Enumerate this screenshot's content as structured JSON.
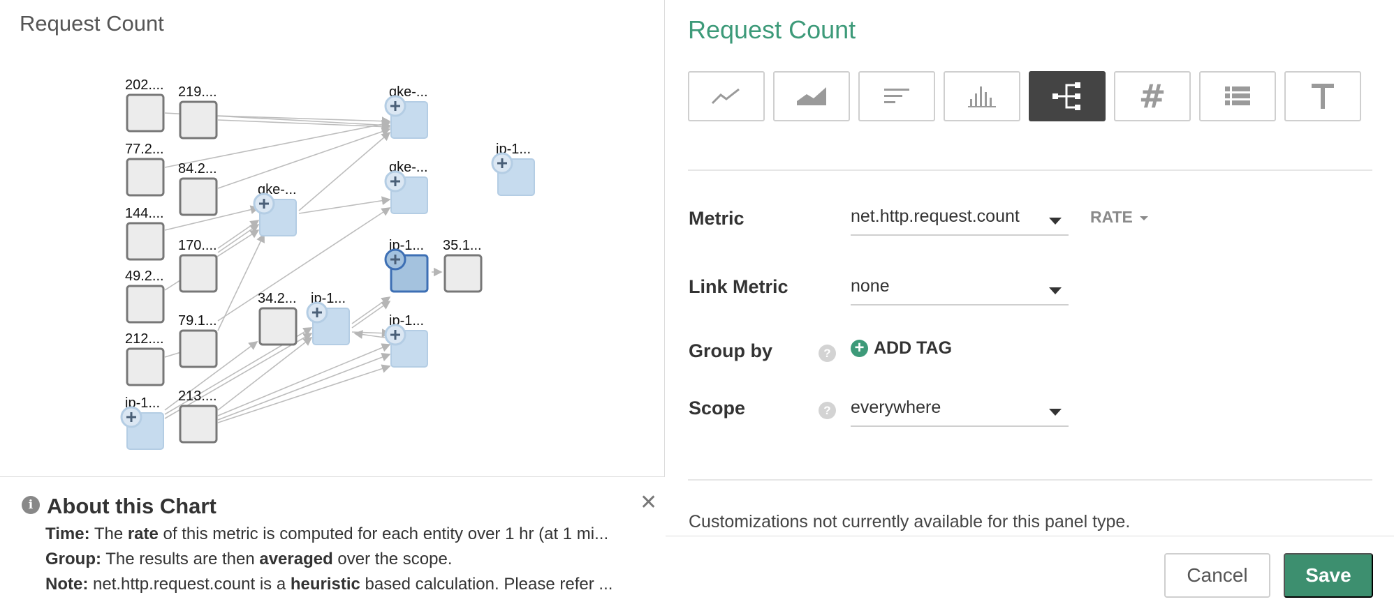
{
  "left": {
    "title": "Request Count"
  },
  "topology": {
    "nodes": [
      {
        "label": "202....",
        "kind": "gray"
      },
      {
        "label": "219....",
        "kind": "gray"
      },
      {
        "label": "77.2...",
        "kind": "gray"
      },
      {
        "label": "84.2...",
        "kind": "gray"
      },
      {
        "label": "144....",
        "kind": "gray"
      },
      {
        "label": "170....",
        "kind": "gray"
      },
      {
        "label": "49.2...",
        "kind": "gray"
      },
      {
        "label": "79.1...",
        "kind": "gray"
      },
      {
        "label": "212....",
        "kind": "gray"
      },
      {
        "label": "213....",
        "kind": "gray"
      },
      {
        "label": "ip-1...",
        "kind": "blue"
      },
      {
        "label": "34.2...",
        "kind": "gray"
      },
      {
        "label": "ip-1...",
        "kind": "blue"
      },
      {
        "label": "gke-...",
        "kind": "blue"
      },
      {
        "label": "gke-...",
        "kind": "blue"
      },
      {
        "label": "gke-...",
        "kind": "blue"
      },
      {
        "label": "ip-1...",
        "kind": "selected"
      },
      {
        "label": "35.1...",
        "kind": "gray"
      },
      {
        "label": "ip-1...",
        "kind": "blue"
      },
      {
        "label": "ip-1...",
        "kind": "blue"
      }
    ]
  },
  "about": {
    "title": "About this Chart",
    "close_icon": "close-icon",
    "time_label": "Time:",
    "time_pre": "The ",
    "time_bold": "rate",
    "time_post": " of this metric is computed for each entity over 1 hr (at 1 mi...",
    "group_label": "Group:",
    "group_pre": "The results are then ",
    "group_bold": "averaged",
    "group_post": " over the scope.",
    "note_label": "Note:",
    "note_pre": "net.http.request.count is a ",
    "note_bold": "heuristic",
    "note_post": " based calculation. Please refer ..."
  },
  "right": {
    "title": "Request Count",
    "viz_types": [
      {
        "icon": "line-chart-icon",
        "active": false
      },
      {
        "icon": "area-chart-icon",
        "active": false
      },
      {
        "icon": "toplist-icon",
        "active": false
      },
      {
        "icon": "histogram-icon",
        "active": false
      },
      {
        "icon": "topology-icon",
        "active": true
      },
      {
        "icon": "number-icon",
        "active": false
      },
      {
        "icon": "list-icon",
        "active": false
      },
      {
        "icon": "text-icon",
        "active": false
      }
    ],
    "metric_label": "Metric",
    "metric_value": "net.http.request.count",
    "rate_label": "RATE",
    "link_metric_label": "Link Metric",
    "link_metric_value": "none",
    "group_by_label": "Group by",
    "add_tag_label": "ADD TAG",
    "scope_label": "Scope",
    "scope_value": "everywhere",
    "custom_note": "Customizations not currently available for this panel type.",
    "cancel_label": "Cancel",
    "save_label": "Save",
    "accent_color": "#3d9a79"
  }
}
